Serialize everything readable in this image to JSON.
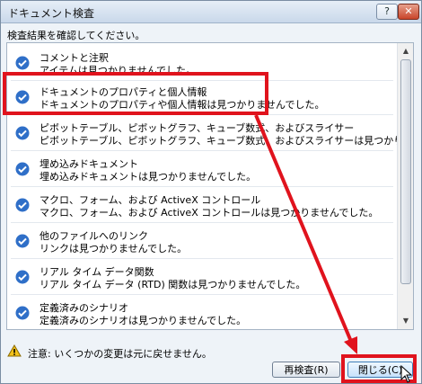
{
  "window": {
    "title": "ドキュメント検査",
    "help_label": "?",
    "close_label": "✕"
  },
  "subtitle": "検査結果を確認してください。",
  "items": [
    {
      "heading": "コメントと注釈",
      "detail": "アイテムは見つかりませんでした。"
    },
    {
      "heading": "ドキュメントのプロパティと個人情報",
      "detail": "ドキュメントのプロパティや個人情報は見つかりませんでした。"
    },
    {
      "heading": "ピボットテーブル、ピボットグラフ、キューブ数式、およびスライサー",
      "detail": "ピボットテーブル、ピボットグラフ、キューブ数式、およびスライサーは見つかりませんでした。"
    },
    {
      "heading": "埋め込みドキュメント",
      "detail": "埋め込みドキュメントは見つかりませんでした。"
    },
    {
      "heading": "マクロ、フォーム、および ActiveX コントロール",
      "detail": "マクロ、フォーム、および ActiveX コントロールは見つかりませんでした。"
    },
    {
      "heading": "他のファイルへのリンク",
      "detail": "リンクは見つかりませんでした。"
    },
    {
      "heading": "リアル タイム データ関数",
      "detail": "リアル タイム データ (RTD) 関数は見つかりませんでした。"
    },
    {
      "heading": "定義済みのシナリオ",
      "detail": "定義済みのシナリオは見つかりませんでした。"
    }
  ],
  "footer": {
    "warning": "注意: いくつかの変更は元に戻せません。",
    "recheck_label": "再検査(R)",
    "close_label": "閉じる(C)"
  },
  "colors": {
    "accent_highlight": "#e0131d",
    "check_blue": "#2f6fc8"
  }
}
